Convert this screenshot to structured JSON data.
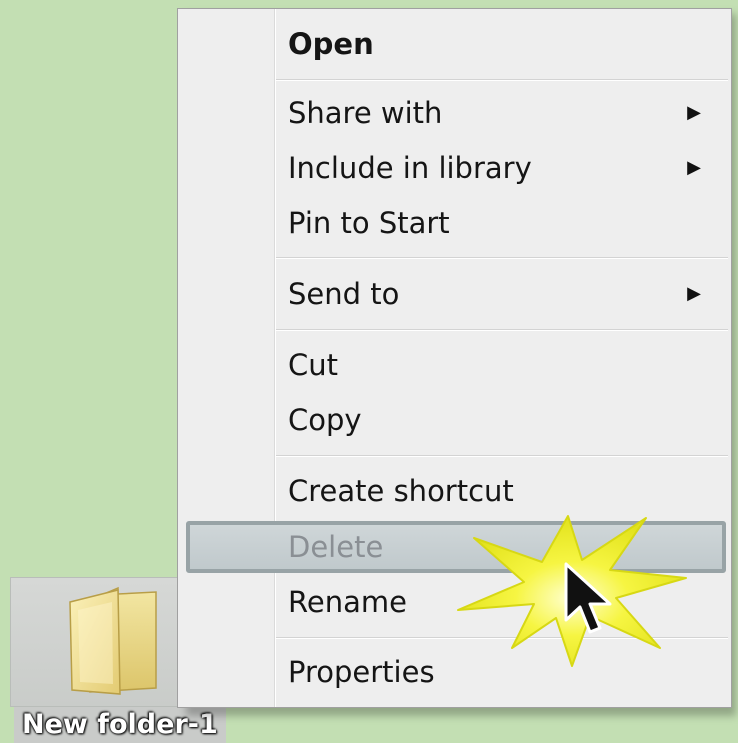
{
  "desktop": {
    "background": "#c3dfb3",
    "folder": {
      "label": "New folder-1",
      "icon": "folder-icon"
    }
  },
  "context_menu": {
    "items": [
      {
        "label": "Open",
        "bold": true
      },
      {
        "label": "Share with",
        "submenu": true
      },
      {
        "label": "Include in library",
        "submenu": true
      },
      {
        "label": "Pin to Start"
      },
      {
        "label": "Send to",
        "submenu": true
      },
      {
        "label": "Cut"
      },
      {
        "label": "Copy"
      },
      {
        "label": "Create shortcut"
      },
      {
        "label": "Delete",
        "highlighted": true
      },
      {
        "label": "Rename"
      },
      {
        "label": "Properties"
      }
    ],
    "submenu_arrow": "▶",
    "highlight_color": "#c6ced1"
  },
  "pointer": {
    "icon": "arrow-cursor-icon",
    "effect": "click-burst-icon",
    "burst_color": "#f3f33a"
  }
}
